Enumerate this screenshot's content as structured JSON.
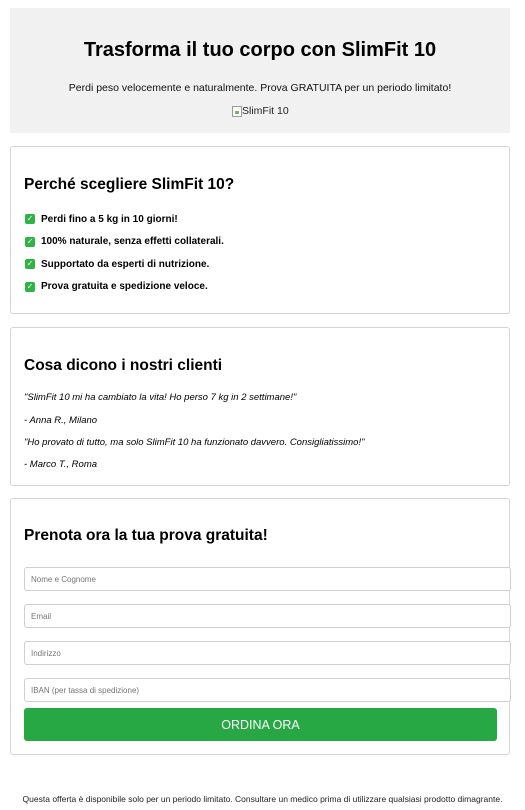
{
  "hero": {
    "title": "Trasforma il tuo corpo con SlimFit 10",
    "subtitle": "Perdi peso velocemente e naturalmente. Prova GRATUITA per un periodo limitato!",
    "image_alt": "SlimFit 10"
  },
  "features": {
    "heading": "Perché scegliere SlimFit 10?",
    "check_icon": "check-icon",
    "check_color": "#2fb344",
    "items": [
      "Perdi fino a 5 kg in 10 giorni!",
      "100% naturale, senza effetti collaterali.",
      "Supportato da esperti di nutrizione.",
      "Prova gratuita e spedizione veloce."
    ]
  },
  "testimonials": {
    "heading": "Cosa dicono i nostri clienti",
    "items": [
      {
        "quote": "\"SlimFit 10 mi ha cambiato la vita! Ho perso 7 kg in 2 settimane!\"",
        "author": "- Anna R., Milano"
      },
      {
        "quote": "\"Ho provato di tutto, ma solo SlimFit 10 ha funzionato davvero. Consigliatissimo!\"",
        "author": "- Marco T., Roma"
      }
    ]
  },
  "order": {
    "heading": "Prenota ora la tua prova gratuita!",
    "fields": {
      "name": {
        "placeholder": "Nome e Cognome",
        "value": ""
      },
      "email": {
        "placeholder": "Email",
        "value": ""
      },
      "address": {
        "placeholder": "Indirizzo",
        "value": ""
      },
      "iban": {
        "placeholder": "IBAN (per tassa di spedizione)",
        "value": ""
      }
    },
    "button_label": "ORDINA ORA",
    "button_color": "#28a745"
  },
  "footer": {
    "text": "Questa offerta è disponibile solo per un periodo limitato. Consultare un medico prima di utilizzare qualsiasi prodotto dimagrante."
  }
}
